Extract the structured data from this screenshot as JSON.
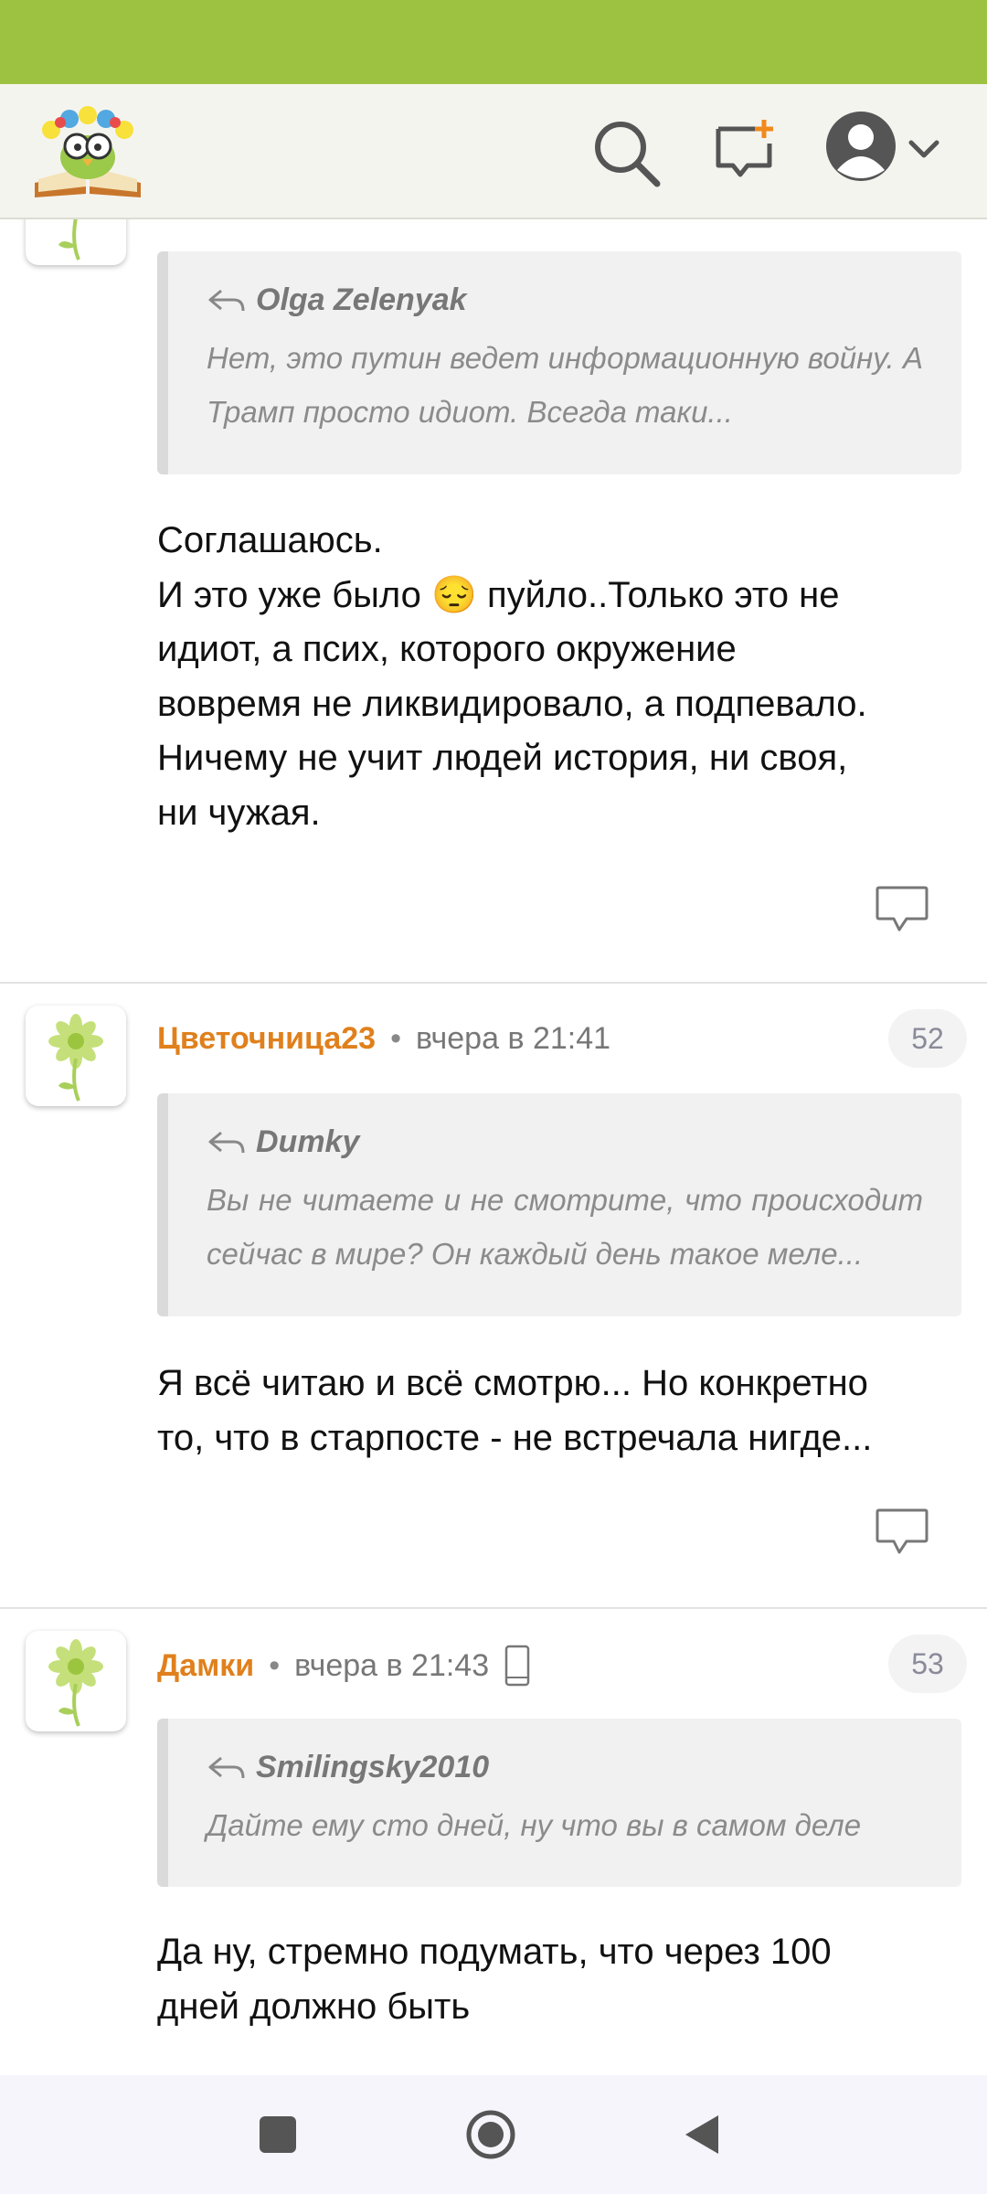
{
  "header": {
    "logo_icon": "book-owl-flowers-logo",
    "search_icon": "search-icon",
    "new_post_icon": "new-post-icon",
    "profile_icon": "avatar-icon",
    "dropdown_icon": "chevron-down-icon"
  },
  "comments": [
    {
      "quote_author": "Olga Zelenyak",
      "quote_text": "Нет, это путин ведет информационную войну. А Трамп просто идиот. Всегда таки...",
      "body_lines": [
        "Соглашаюсь.",
        "И это уже было",
        "пуйло..Только это не",
        "идиот, а псих, которого окружение",
        "вовремя не ликвидировало, а подпевало.",
        "Ничему не учит людей история, ни своя,",
        "ни чужая."
      ],
      "emoji": "😔"
    },
    {
      "author": "Цветочница23",
      "separator": "•",
      "time": "вчера в 21:41",
      "number": "52",
      "quote_author": "Dumky",
      "quote_text": "Вы не читаете и не смотрите, что происходит сейчас в мире? Он каждый день такое меле...",
      "body_lines": [
        "Я всё читаю и всё смотрю... Но конкретно",
        "то, что в старпосте - не встречала нигде..."
      ]
    },
    {
      "author": "Дамки",
      "separator": "•",
      "time": "вчера в 21:43",
      "number": "53",
      "device_icon": "mobile-phone-icon",
      "quote_author": "Smilingsky2010",
      "quote_text": "Дайте ему сто дней, ну что вы в самом деле",
      "body_lines": [
        "Да ну, стремно подумать, что через 100",
        "дней должно быть"
      ]
    }
  ],
  "colors": {
    "status_bar": "#9dc141",
    "author": "#e0801c",
    "quote_bg": "#f1f1f1"
  },
  "navbar": {
    "recent_icon": "square-recent-apps-icon",
    "home_icon": "circle-home-icon",
    "back_icon": "triangle-back-icon"
  }
}
